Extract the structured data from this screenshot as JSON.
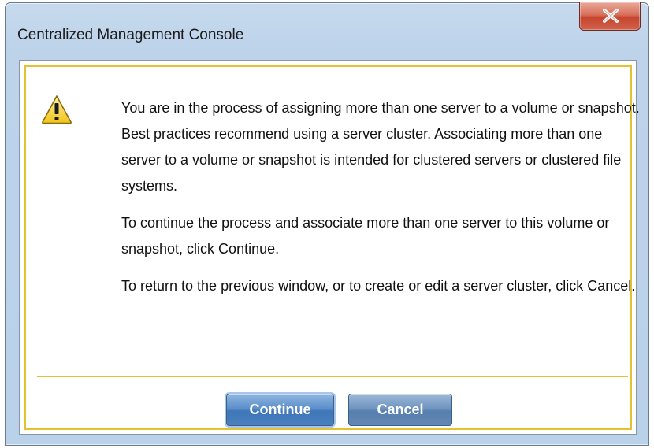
{
  "window": {
    "title": "Centralized Management Console",
    "close_icon": "close-x-icon"
  },
  "dialog": {
    "icon": "warning-icon",
    "paragraphs": [
      "You are in the process of assigning more than one server to a volume or snapshot. Best practices recommend using a server cluster. Associating more than one server to a volume or snapshot is intended for clustered servers or clustered file systems.",
      "To continue the process and associate more than one server to this volume or snapshot, click Continue.",
      "To return to the previous window, or to create or edit a server cluster, click Cancel."
    ]
  },
  "buttons": {
    "continue_label": "Continue",
    "cancel_label": "Cancel"
  },
  "colors": {
    "frame_accent": "#e3c232",
    "close_button": "#c7452e",
    "button_blue": "#4a80bf"
  }
}
